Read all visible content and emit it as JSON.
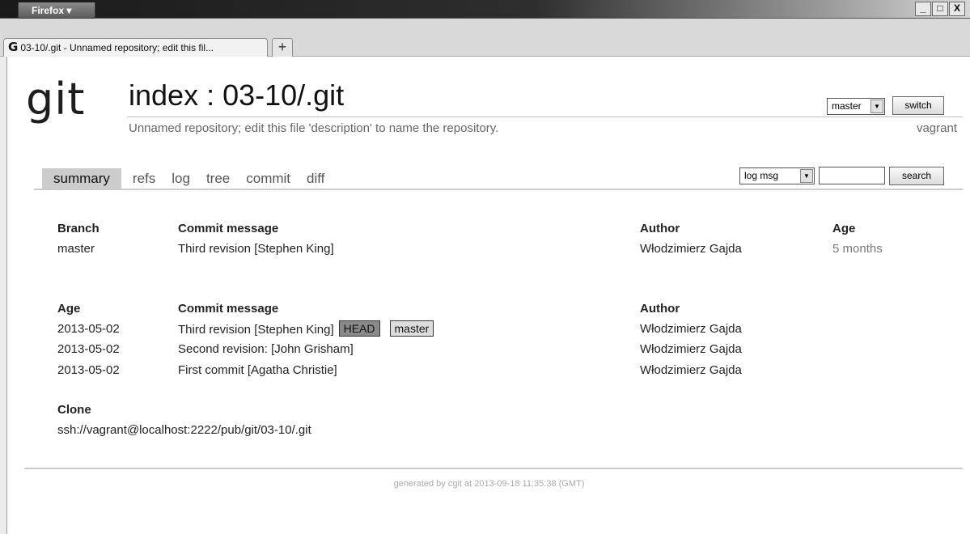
{
  "browser": {
    "menu_label": "Firefox ▾",
    "tab_icon": "G",
    "tab_title": "03-10/.git - Unnamed repository; edit this fil...",
    "new_tab": "+",
    "controls": {
      "minimize": "_",
      "maximize": "□",
      "close": "X"
    }
  },
  "header": {
    "logo": "git",
    "title": "index : 03-10/.git",
    "description": "Unnamed repository; edit this file 'description' to name the repository.",
    "owner": "vagrant",
    "branch_select": "master",
    "switch_label": "switch"
  },
  "nav": {
    "tabs": [
      "summary",
      "refs",
      "log",
      "tree",
      "commit",
      "diff"
    ],
    "active": "summary",
    "search_mode": "log msg",
    "search_value": "",
    "search_label": "search"
  },
  "branches": {
    "headers": {
      "branch": "Branch",
      "message": "Commit message",
      "author": "Author",
      "age": "Age"
    },
    "rows": [
      {
        "branch": "master",
        "message": "Third revision [Stephen King]",
        "author": "Włodzimierz Gajda",
        "age": "5 months"
      }
    ]
  },
  "commits": {
    "headers": {
      "age": "Age",
      "message": "Commit message",
      "author": "Author"
    },
    "rows": [
      {
        "age": "2013-05-02",
        "message": "Third revision [Stephen King]",
        "head_badge": "HEAD",
        "branch_badge": "master",
        "author": "Włodzimierz Gajda"
      },
      {
        "age": "2013-05-02",
        "message": "Second revision: [John Grisham]",
        "author": "Włodzimierz Gajda"
      },
      {
        "age": "2013-05-02",
        "message": "First commit [Agatha Christie]",
        "author": "Włodzimierz Gajda"
      }
    ]
  },
  "clone": {
    "label": "Clone",
    "url": "ssh://vagrant@localhost:2222/pub/git/03-10/.git"
  },
  "footer": "generated by cgit at 2013-09-18 11:35:38 (GMT)"
}
